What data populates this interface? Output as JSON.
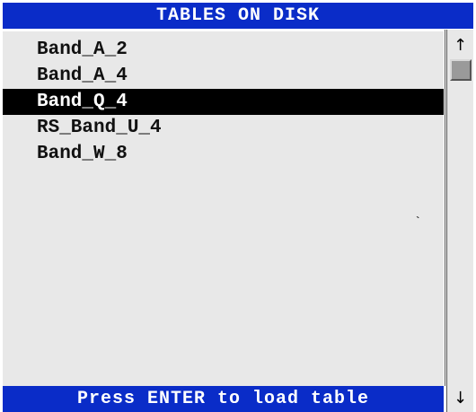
{
  "dialog": {
    "title": "TABLES ON DISK",
    "footer_hint": "Press ENTER to load table",
    "stray_mark": "`"
  },
  "list": {
    "items": [
      {
        "label": "Band_A_2",
        "selected": false
      },
      {
        "label": "Band_A_4",
        "selected": false
      },
      {
        "label": "Band_Q_4",
        "selected": true
      },
      {
        "label": "RS_Band_U_4",
        "selected": false
      },
      {
        "label": "Band_W_8",
        "selected": false
      }
    ]
  },
  "scrollbar": {
    "up_icon": "arrow-up",
    "down_icon": "arrow-down",
    "up_glyph": "↑",
    "down_glyph": "↓"
  },
  "colors": {
    "title_background": "#0a2cc8",
    "list_background": "#e8e8e8",
    "selection_background": "#000000",
    "selection_text": "#ffffff"
  }
}
